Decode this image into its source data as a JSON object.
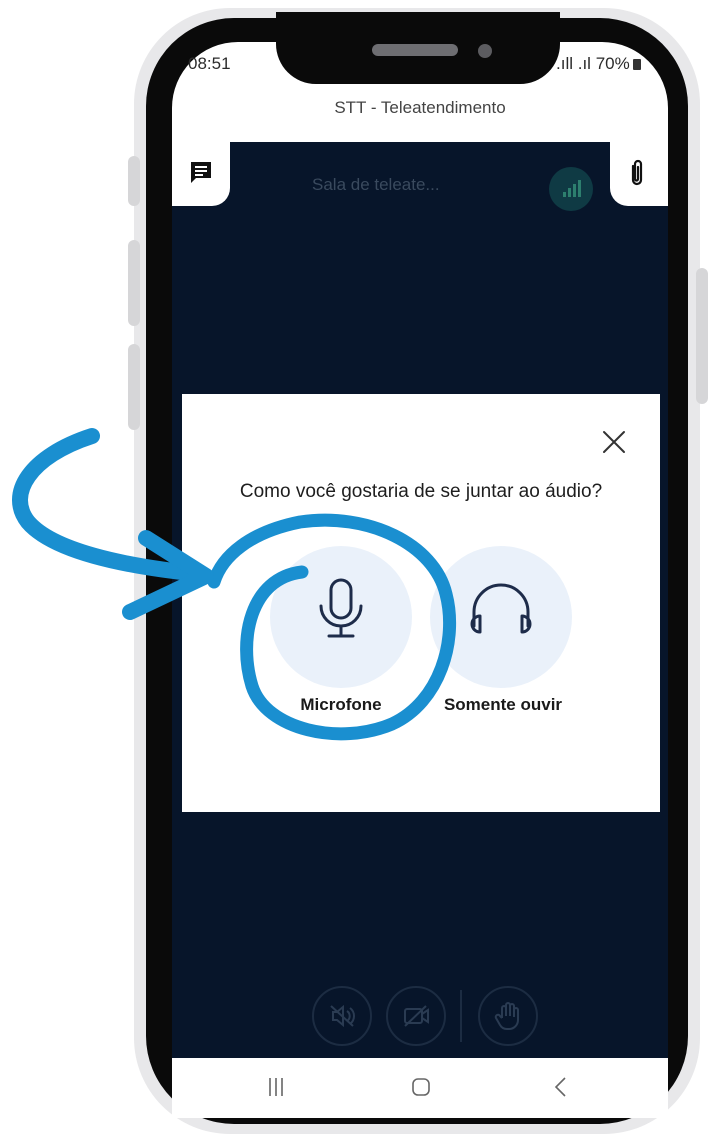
{
  "status_bar": {
    "time": "08:51",
    "signal": ".ıll .ıl",
    "battery": "70%"
  },
  "app": {
    "title": "STT - Teleatendimento"
  },
  "call": {
    "room_title": "Sala de teleate..."
  },
  "audio_dialog": {
    "question": "Como você gostaria de se juntar ao áudio?",
    "options": [
      {
        "label": "Microfone",
        "icon": "microphone-icon"
      },
      {
        "label": "Somente ouvir",
        "icon": "headphones-icon"
      }
    ],
    "close_icon": "close-icon"
  },
  "toolbar": {
    "buttons": [
      "speaker-mute-icon",
      "video-off-icon",
      "raise-hand-icon"
    ]
  },
  "nav": {
    "buttons": [
      "recent-apps-icon",
      "home-icon",
      "back-icon"
    ]
  },
  "colors": {
    "accent_annotation": "#1a8fd0",
    "call_background": "#07152a",
    "option_circle": "#eaf1fa"
  }
}
